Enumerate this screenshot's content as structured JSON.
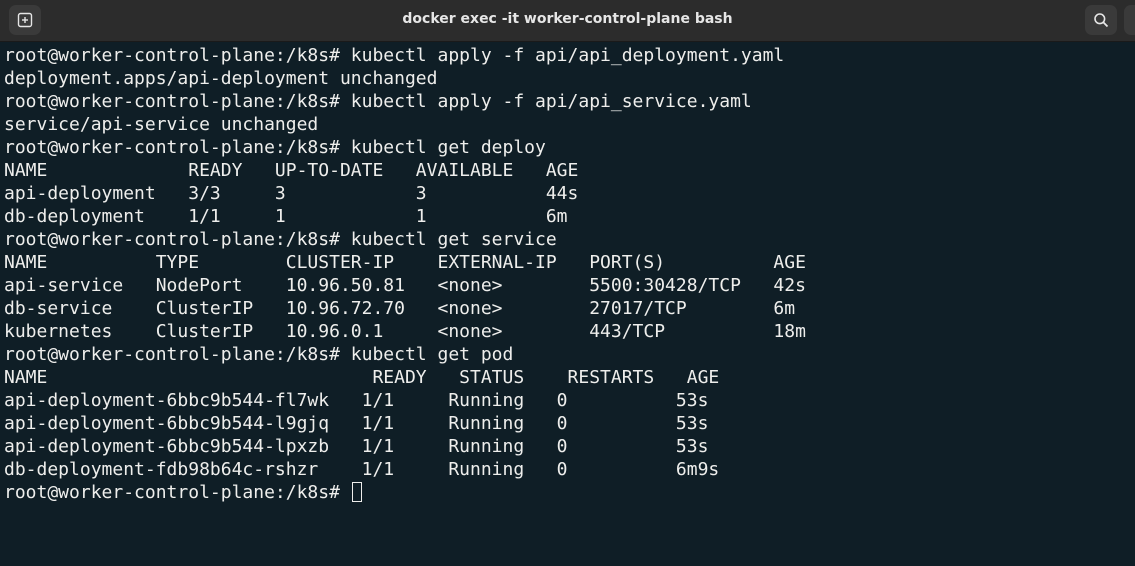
{
  "window": {
    "title": "docker exec -it worker-control-plane bash"
  },
  "titlebar": {
    "new_tab_icon": "new-tab-icon",
    "search_icon": "search-icon"
  },
  "colors": {
    "terminal_bg": "#0f1e26",
    "terminal_fg": "#eeeeec",
    "titlebar_bg": "#2c2c2c"
  },
  "terminal": {
    "lines": [
      "root@worker-control-plane:/k8s# kubectl apply -f api/api_deployment.yaml",
      "deployment.apps/api-deployment unchanged",
      "root@worker-control-plane:/k8s# kubectl apply -f api/api_service.yaml",
      "service/api-service unchanged",
      "root@worker-control-plane:/k8s# kubectl get deploy",
      "NAME             READY   UP-TO-DATE   AVAILABLE   AGE",
      "api-deployment   3/3     3            3           44s",
      "db-deployment    1/1     1            1           6m",
      "root@worker-control-plane:/k8s# kubectl get service",
      "NAME          TYPE        CLUSTER-IP    EXTERNAL-IP   PORT(S)          AGE",
      "api-service   NodePort    10.96.50.81   <none>        5500:30428/TCP   42s",
      "db-service    ClusterIP   10.96.72.70   <none>        27017/TCP        6m",
      "kubernetes    ClusterIP   10.96.0.1     <none>        443/TCP          18m",
      "root@worker-control-plane:/k8s# kubectl get pod",
      "NAME                              READY   STATUS    RESTARTS   AGE",
      "api-deployment-6bbc9b544-fl7wk   1/1     Running   0          53s",
      "api-deployment-6bbc9b544-l9gjq   1/1     Running   0          53s",
      "api-deployment-6bbc9b544-lpxzb   1/1     Running   0          53s",
      "db-deployment-fdb98b64c-rshzr    1/1     Running   0          6m9s"
    ],
    "prompt": "root@worker-control-plane:/k8s# "
  }
}
